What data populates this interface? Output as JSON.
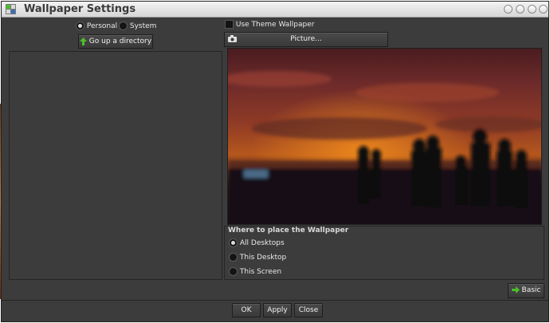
{
  "window": {
    "title": "Wallpaper Settings"
  },
  "colors": {
    "background": "#3c3c3c",
    "accent_green": "#4cbf2a",
    "sky_orange": "#b4561d"
  },
  "source": {
    "personal_label": "Personal",
    "system_label": "System",
    "selected": "Personal"
  },
  "browser": {
    "up_button_label": "Go up a directory"
  },
  "theme": {
    "use_theme_label": "Use Theme Wallpaper",
    "checked": false
  },
  "picture": {
    "button_label": "Picture..."
  },
  "placement": {
    "group_label": "Where to place the Wallpaper",
    "options": [
      "All Desktops",
      "This Desktop",
      "This Screen"
    ],
    "selected": "All Desktops"
  },
  "footer": {
    "basic_label": "Basic",
    "ok_label": "OK",
    "apply_label": "Apply",
    "close_label": "Close"
  }
}
